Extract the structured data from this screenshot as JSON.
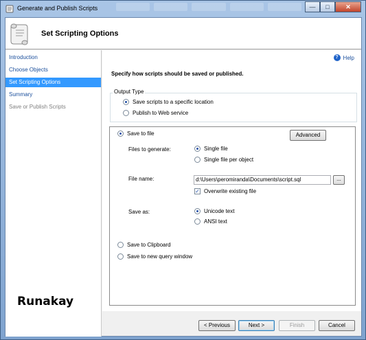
{
  "window": {
    "title": "Generate and Publish Scripts",
    "controls": {
      "minimize": "—",
      "maximize": "□",
      "close": "✕"
    }
  },
  "header": {
    "title": "Set Scripting Options"
  },
  "nav": {
    "items": [
      {
        "label": "Introduction",
        "state": "link"
      },
      {
        "label": "Choose Objects",
        "state": "link"
      },
      {
        "label": "Set Scripting Options",
        "state": "active"
      },
      {
        "label": "Summary",
        "state": "link"
      },
      {
        "label": "Save or Publish Scripts",
        "state": "disabled"
      }
    ]
  },
  "help": {
    "label": "Help"
  },
  "instruction": "Specify how scripts should be saved or published.",
  "output_type": {
    "label": "Output Type",
    "options": [
      {
        "label": "Save scripts to a specific location",
        "selected": true
      },
      {
        "label": "Publish to Web service",
        "selected": false
      }
    ]
  },
  "save_options": {
    "save_to_file": {
      "label": "Save to file",
      "selected": true
    },
    "advanced_button": "Advanced",
    "files_to_generate": {
      "label": "Files to generate:",
      "options": [
        {
          "label": "Single file",
          "selected": true
        },
        {
          "label": "Single file per object",
          "selected": false
        }
      ]
    },
    "file_name": {
      "label": "File name:",
      "value": "d:\\Users\\peromiranda\\Documents\\script.sql",
      "browse": "..."
    },
    "overwrite": {
      "label": "Overwrite existing file",
      "checked": true
    },
    "save_as": {
      "label": "Save as:",
      "options": [
        {
          "label": "Unicode text",
          "selected": true
        },
        {
          "label": "ANSI text",
          "selected": false
        }
      ]
    },
    "save_to_clipboard": {
      "label": "Save to Clipboard",
      "selected": false
    },
    "save_to_query_window": {
      "label": "Save to new query window",
      "selected": false
    }
  },
  "footer": {
    "previous": "< Previous",
    "next": "Next >",
    "finish": "Finish",
    "cancel": "Cancel"
  },
  "watermark": "Runakay",
  "colors": {
    "accent": "#3399ff",
    "link": "#1b4f9c"
  }
}
